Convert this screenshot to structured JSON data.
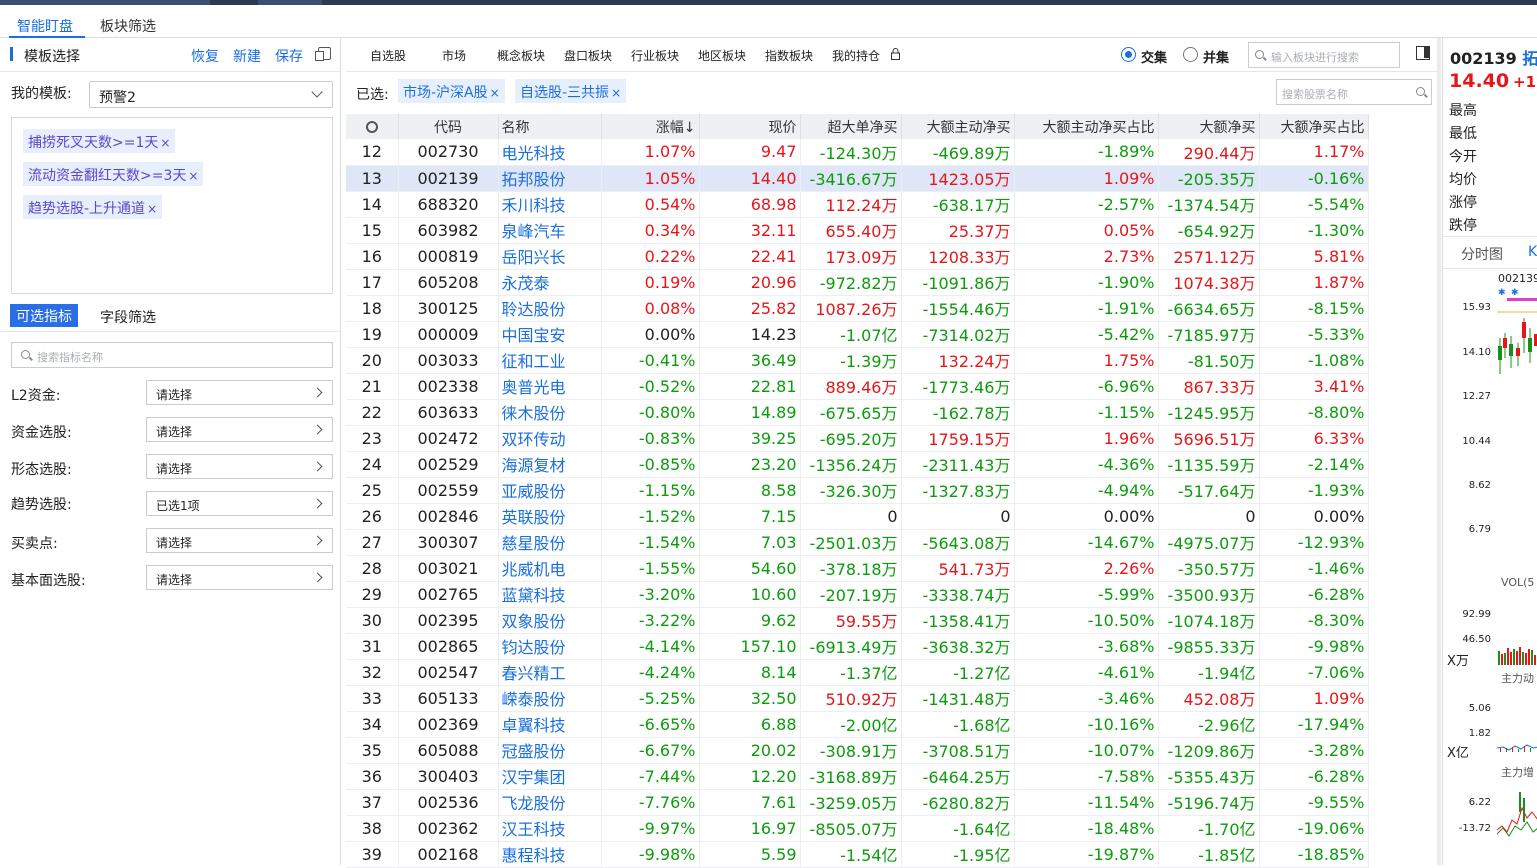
{
  "app": {
    "tabs": [
      "智能盯盘",
      "板块筛选"
    ]
  },
  "left": {
    "title": "模板选择",
    "actions": [
      "恢复",
      "新建",
      "保存"
    ],
    "template_label": "我的模板:",
    "template_value": "预警2",
    "conditions": [
      "捕捞死叉天数>=1天",
      "流动资金翻红天数>=3天",
      "趋势选股-上升通道"
    ],
    "subtabs": [
      "可选指标",
      "字段筛选"
    ],
    "search_placeholder": "搜索指标名称",
    "filters": [
      {
        "label": "L2资金:",
        "value": "请选择"
      },
      {
        "label": "资金选股:",
        "value": "请选择"
      },
      {
        "label": "形态选股:",
        "value": "请选择"
      },
      {
        "label": "趋势选股:",
        "value": "已选1项"
      },
      {
        "label": "买卖点:",
        "value": "请选择"
      },
      {
        "label": "基本面选股:",
        "value": "请选择"
      }
    ]
  },
  "main": {
    "categories": [
      "自选股",
      "市场",
      "概念板块",
      "盘口板块",
      "行业板块",
      "地区板块",
      "指数板块",
      "我的持仓"
    ],
    "radio_options": [
      "交集",
      "并集"
    ],
    "radio_selected": "交集",
    "board_search_placeholder": "输入板块进行搜索",
    "selected_label": "已选:",
    "selected_tags": [
      "市场-沪深A股",
      "自选股-三共振"
    ],
    "stock_search_placeholder": "搜索股票名称",
    "columns": [
      "代码",
      "名称",
      "涨幅↓",
      "现价",
      "超大单净买",
      "大额主动净买",
      "大额主动净买占比",
      "大额净买",
      "大额净买占比"
    ],
    "highlighted_row": 1,
    "rows": [
      [
        "12",
        "002730",
        "电光科技",
        "1.07%",
        "9.47",
        "-124.30万",
        "-469.89万",
        "-1.89%",
        "290.44万",
        "1.17%"
      ],
      [
        "13",
        "002139",
        "拓邦股份",
        "1.05%",
        "14.40",
        "-3416.67万",
        "1423.05万",
        "1.09%",
        "-205.35万",
        "-0.16%"
      ],
      [
        "14",
        "688320",
        "禾川科技",
        "0.54%",
        "68.98",
        "112.24万",
        "-638.17万",
        "-2.57%",
        "-1374.54万",
        "-5.54%"
      ],
      [
        "15",
        "603982",
        "泉峰汽车",
        "0.34%",
        "32.11",
        "655.40万",
        "25.37万",
        "0.05%",
        "-654.92万",
        "-1.30%"
      ],
      [
        "16",
        "000819",
        "岳阳兴长",
        "0.22%",
        "22.41",
        "173.09万",
        "1208.33万",
        "2.73%",
        "2571.12万",
        "5.81%"
      ],
      [
        "17",
        "605208",
        "永茂泰",
        "0.19%",
        "20.96",
        "-972.82万",
        "-1091.86万",
        "-1.90%",
        "1074.38万",
        "1.87%"
      ],
      [
        "18",
        "300125",
        "聆达股份",
        "0.08%",
        "25.82",
        "1087.26万",
        "-1554.46万",
        "-1.91%",
        "-6634.65万",
        "-8.15%"
      ],
      [
        "19",
        "000009",
        "中国宝安",
        "0.00%",
        "14.23",
        "-1.07亿",
        "-7314.02万",
        "-5.42%",
        "-7185.97万",
        "-5.33%"
      ],
      [
        "20",
        "003033",
        "征和工业",
        "-0.41%",
        "36.49",
        "-1.39万",
        "132.24万",
        "1.75%",
        "-81.50万",
        "-1.08%"
      ],
      [
        "21",
        "002338",
        "奥普光电",
        "-0.52%",
        "22.81",
        "889.46万",
        "-1773.46万",
        "-6.96%",
        "867.33万",
        "3.41%"
      ],
      [
        "22",
        "603633",
        "徕木股份",
        "-0.80%",
        "14.89",
        "-675.65万",
        "-162.78万",
        "-1.15%",
        "-1245.95万",
        "-8.80%"
      ],
      [
        "23",
        "002472",
        "双环传动",
        "-0.83%",
        "39.25",
        "-695.20万",
        "1759.15万",
        "1.96%",
        "5696.51万",
        "6.33%"
      ],
      [
        "24",
        "002529",
        "海源复材",
        "-0.85%",
        "23.20",
        "-1356.24万",
        "-2311.43万",
        "-4.36%",
        "-1135.59万",
        "-2.14%"
      ],
      [
        "25",
        "002559",
        "亚威股份",
        "-1.15%",
        "8.58",
        "-326.30万",
        "-1327.83万",
        "-4.94%",
        "-517.64万",
        "-1.93%"
      ],
      [
        "26",
        "002846",
        "英联股份",
        "-1.52%",
        "7.15",
        "0",
        "0",
        "0.00%",
        "0",
        "0.00%"
      ],
      [
        "27",
        "300307",
        "慈星股份",
        "-1.54%",
        "7.03",
        "-2501.03万",
        "-5643.08万",
        "-14.67%",
        "-4975.07万",
        "-12.93%"
      ],
      [
        "28",
        "003021",
        "兆威机电",
        "-1.55%",
        "54.60",
        "-378.18万",
        "541.73万",
        "2.26%",
        "-350.57万",
        "-1.46%"
      ],
      [
        "29",
        "002765",
        "蓝黛科技",
        "-3.20%",
        "10.60",
        "-207.19万",
        "-3338.74万",
        "-5.99%",
        "-3500.93万",
        "-6.28%"
      ],
      [
        "30",
        "002395",
        "双象股份",
        "-3.22%",
        "9.62",
        "59.55万",
        "-1358.41万",
        "-10.50%",
        "-1074.18万",
        "-8.30%"
      ],
      [
        "31",
        "002865",
        "钧达股份",
        "-4.14%",
        "157.10",
        "-6913.49万",
        "-3638.32万",
        "-3.68%",
        "-9855.33万",
        "-9.98%"
      ],
      [
        "32",
        "002547",
        "春兴精工",
        "-4.24%",
        "8.14",
        "-1.37亿",
        "-1.27亿",
        "-4.61%",
        "-1.94亿",
        "-7.06%"
      ],
      [
        "33",
        "605133",
        "嵘泰股份",
        "-5.25%",
        "32.50",
        "510.92万",
        "-1431.48万",
        "-3.46%",
        "452.08万",
        "1.09%"
      ],
      [
        "34",
        "002369",
        "卓翼科技",
        "-6.65%",
        "6.88",
        "-2.00亿",
        "-1.68亿",
        "-10.16%",
        "-2.96亿",
        "-17.94%"
      ],
      [
        "35",
        "605088",
        "冠盛股份",
        "-6.67%",
        "20.02",
        "-308.91万",
        "-3708.51万",
        "-10.07%",
        "-1209.86万",
        "-3.28%"
      ],
      [
        "36",
        "300403",
        "汉宇集团",
        "-7.44%",
        "12.20",
        "-3168.89万",
        "-6464.25万",
        "-7.58%",
        "-5355.43万",
        "-6.28%"
      ],
      [
        "37",
        "002536",
        "飞龙股份",
        "-7.76%",
        "7.61",
        "-3259.05万",
        "-6280.82万",
        "-11.54%",
        "-5196.74万",
        "-9.55%"
      ],
      [
        "38",
        "002362",
        "汉王科技",
        "-9.97%",
        "16.97",
        "-8505.07万",
        "-1.64亿",
        "-18.48%",
        "-1.70亿",
        "-19.06%"
      ],
      [
        "39",
        "002168",
        "惠程科技",
        "-9.98%",
        "5.59",
        "-1.54亿",
        "-1.95亿",
        "-19.87%",
        "-1.85亿",
        "-18.85%"
      ]
    ]
  },
  "right": {
    "code": "002139",
    "name_partial": "拓邦",
    "price": "14.40",
    "change_partial": "+1.0",
    "quote_labels": [
      "最高",
      "最低",
      "今开",
      "均价",
      "涨停",
      "跌停"
    ],
    "tabs": [
      "分时图",
      "K"
    ],
    "chart_code": "002139",
    "price_axis": [
      "15.93",
      "14.10",
      "12.27",
      "10.44",
      "8.62",
      "6.79"
    ],
    "vol_label": "VOL(5",
    "vol_axis": [
      "92.99",
      "46.50"
    ],
    "vol_unit": "X万",
    "flow_label": "主力动",
    "flow_axis": [
      "5.06",
      "1.82"
    ],
    "flow_unit": "X亿",
    "inc_label": "主力增",
    "inc_axis": [
      "6.22",
      "-13.72"
    ]
  },
  "colors": {
    "accent": "#1a6fe0",
    "up": "#e5161a",
    "down": "#0c9b0c",
    "highlight": "#dfe6f8"
  }
}
